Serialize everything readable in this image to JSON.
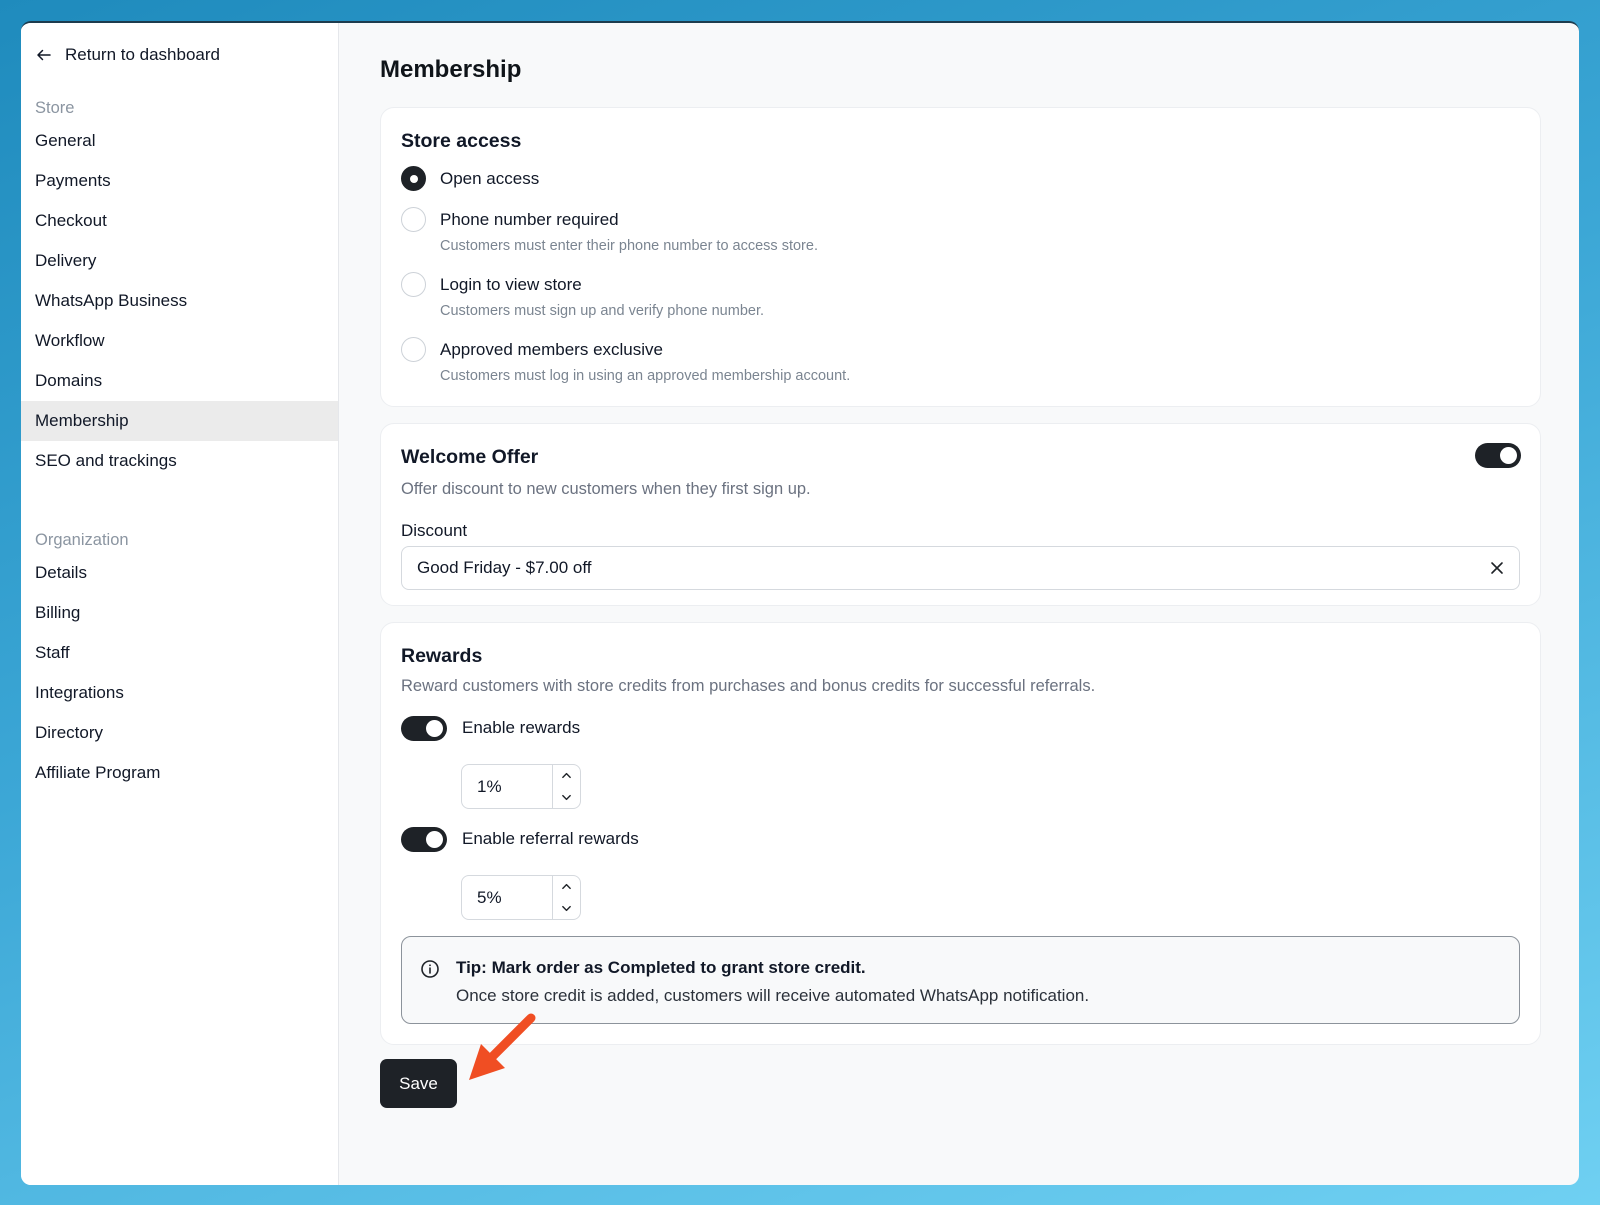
{
  "sidebar": {
    "back_label": "Return to dashboard",
    "store_section": "Store",
    "store_items": [
      "General",
      "Payments",
      "Checkout",
      "Delivery",
      "WhatsApp Business",
      "Workflow",
      "Domains",
      "Membership",
      "SEO and trackings"
    ],
    "active_item": "Membership",
    "org_section": "Organization",
    "org_items": [
      "Details",
      "Billing",
      "Staff",
      "Integrations",
      "Directory",
      "Affiliate Program"
    ]
  },
  "page": {
    "title": "Membership"
  },
  "store_access": {
    "title": "Store access",
    "options": [
      {
        "label": "Open access",
        "sub": "",
        "checked": true
      },
      {
        "label": "Phone number required",
        "sub": "Customers must enter their phone number to access store.",
        "checked": false
      },
      {
        "label": "Login to view store",
        "sub": "Customers must sign up and verify phone number.",
        "checked": false
      },
      {
        "label": "Approved members exclusive",
        "sub": "Customers must log in using an approved membership account.",
        "checked": false
      }
    ]
  },
  "welcome_offer": {
    "title": "Welcome Offer",
    "desc": "Offer discount to new customers when they first sign up.",
    "enabled": true,
    "discount_label": "Discount",
    "discount_value": "Good Friday - $7.00 off"
  },
  "rewards": {
    "title": "Rewards",
    "desc": "Reward customers with store credits from purchases and bonus credits for successful referrals.",
    "enable_rewards_label": "Enable rewards",
    "enable_rewards": true,
    "rewards_value": "1%",
    "enable_referral_label": "Enable referral rewards",
    "enable_referral": true,
    "referral_value": "5%",
    "tip_title": "Tip: Mark order as Completed to grant store credit.",
    "tip_body": "Once store credit is added, customers will receive automated WhatsApp notification."
  },
  "actions": {
    "save_label": "Save"
  },
  "colors": {
    "accent": "#1e2227",
    "annotation_arrow": "#f04e23",
    "active_nav_bg": "#ebebeb"
  }
}
